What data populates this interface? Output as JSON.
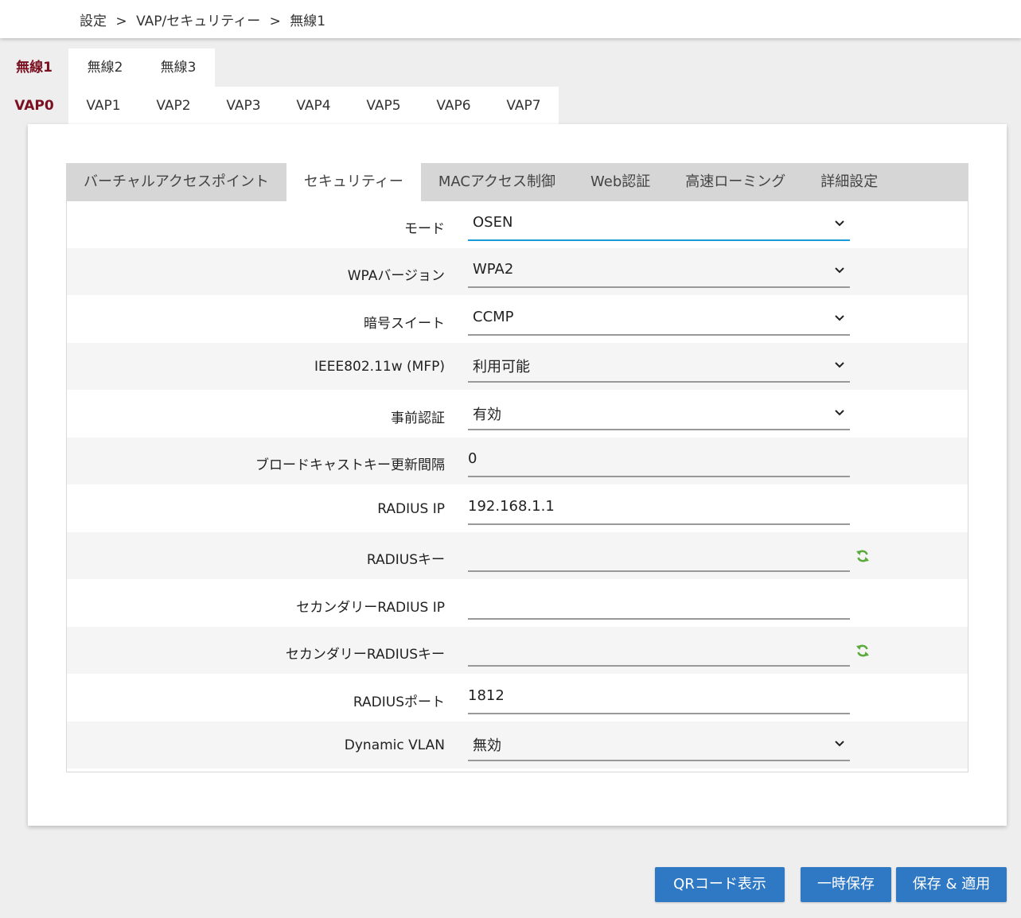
{
  "breadcrumb": [
    "設定",
    ">",
    "VAP/セキュリティー",
    ">",
    "無線1"
  ],
  "radio_tabs": [
    {
      "label": "無線1",
      "active": true
    },
    {
      "label": "無線2",
      "active": false
    },
    {
      "label": "無線3",
      "active": false
    }
  ],
  "vap_tabs": [
    {
      "label": "VAP0",
      "active": true
    },
    {
      "label": "VAP1",
      "active": false
    },
    {
      "label": "VAP2",
      "active": false
    },
    {
      "label": "VAP3",
      "active": false
    },
    {
      "label": "VAP4",
      "active": false
    },
    {
      "label": "VAP5",
      "active": false
    },
    {
      "label": "VAP6",
      "active": false
    },
    {
      "label": "VAP7",
      "active": false
    }
  ],
  "sub_tabs": [
    {
      "label": "バーチャルアクセスポイント",
      "active": false
    },
    {
      "label": "セキュリティー",
      "active": true
    },
    {
      "label": "MACアクセス制御",
      "active": false
    },
    {
      "label": "Web認証",
      "active": false
    },
    {
      "label": "高速ローミング",
      "active": false
    },
    {
      "label": "詳細設定",
      "active": false
    }
  ],
  "form": {
    "rows": [
      {
        "name": "mode",
        "label": "モード",
        "type": "select",
        "value": "OSEN",
        "focused": true
      },
      {
        "name": "wpa-version",
        "label": "WPAバージョン",
        "type": "select",
        "value": "WPA2"
      },
      {
        "name": "cipher-suite",
        "label": "暗号スイート",
        "type": "select",
        "value": "CCMP"
      },
      {
        "name": "ieee80211w",
        "label": "IEEE802.11w (MFP)",
        "type": "select",
        "value": "利用可能"
      },
      {
        "name": "pre-auth",
        "label": "事前認証",
        "type": "select",
        "value": "有効"
      },
      {
        "name": "broadcast-key-interval",
        "label": "ブロードキャストキー更新間隔",
        "type": "text",
        "value": "0"
      },
      {
        "name": "radius-ip",
        "label": "RADIUS IP",
        "type": "text",
        "value": "192.168.1.1"
      },
      {
        "name": "radius-key",
        "label": "RADIUSキー",
        "type": "text",
        "value": "",
        "refresh": true
      },
      {
        "name": "secondary-radius-ip",
        "label": "セカンダリーRADIUS IP",
        "type": "text",
        "value": ""
      },
      {
        "name": "secondary-radius-key",
        "label": "セカンダリーRADIUSキー",
        "type": "text",
        "value": "",
        "refresh": true
      },
      {
        "name": "radius-port",
        "label": "RADIUSポート",
        "type": "text",
        "value": "1812"
      },
      {
        "name": "dynamic-vlan",
        "label": "Dynamic VLAN",
        "type": "select",
        "value": "無効"
      }
    ]
  },
  "buttons": {
    "qr": "QRコード表示",
    "temp_save": "一時保存",
    "save_apply": "保存 & 適用"
  },
  "colors": {
    "accent_active_tab": "#7a1020",
    "focus_underline": "#1a9ad6",
    "button_bg": "#2f78c4",
    "refresh_icon": "#5aaa3c"
  },
  "icons": {
    "select_arrow": "chevron-down-icon",
    "refresh": "refresh-icon"
  }
}
